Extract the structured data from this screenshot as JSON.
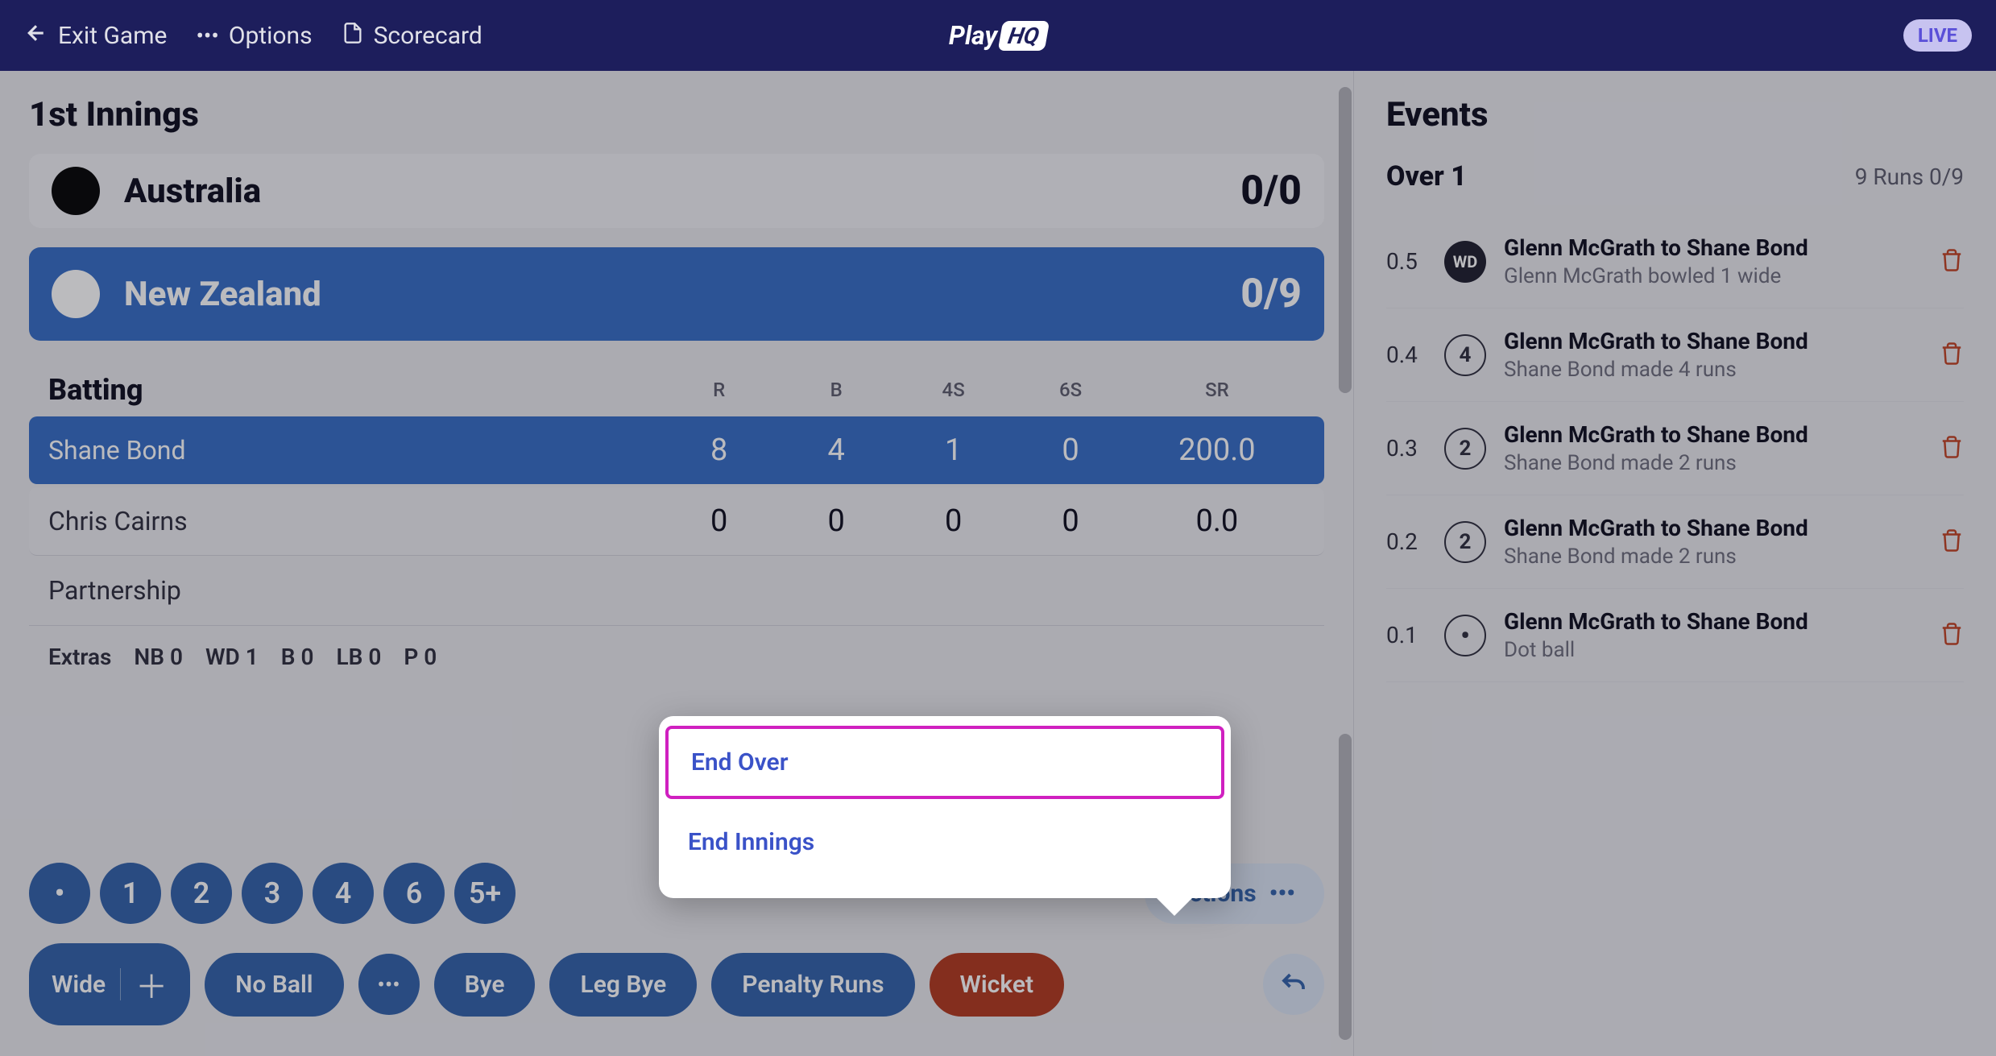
{
  "navbar": {
    "exit_label": "Exit Game",
    "options_label": "Options",
    "scorecard_label": "Scorecard",
    "logo_text": "Play",
    "logo_badge": "HQ",
    "live_label": "LIVE"
  },
  "innings_title": "1st Innings",
  "teams": [
    {
      "name": "Australia",
      "score": "0/0",
      "active": false,
      "dot": "black"
    },
    {
      "name": "New Zealand",
      "score": "0/9",
      "active": true,
      "dot": "white"
    }
  ],
  "batting": {
    "header": "Batting",
    "cols": {
      "r": "R",
      "b": "B",
      "fours": "4S",
      "sixes": "6S",
      "sr": "SR"
    },
    "rows": [
      {
        "name": "Shane Bond",
        "r": "8",
        "b": "4",
        "fours": "1",
        "sixes": "0",
        "sr": "200.0",
        "active": true
      },
      {
        "name": "Chris Cairns",
        "r": "0",
        "b": "0",
        "fours": "0",
        "sixes": "0",
        "sr": "0.0",
        "active": false
      }
    ],
    "partnership_label": "Partnership"
  },
  "extras": {
    "label": "Extras",
    "nb": "NB 0",
    "wd": "WD 1",
    "b": "B 0",
    "lb": "LB 0",
    "p": "P 0"
  },
  "run_buttons": {
    "dot": "•",
    "one": "1",
    "two": "2",
    "three": "3",
    "four": "4",
    "six": "6",
    "fiveplus": "5+"
  },
  "actions": {
    "actions_label": "Actions",
    "wide": "Wide",
    "noball": "No Ball",
    "bye": "Bye",
    "legbye": "Leg Bye",
    "penalty": "Penalty Runs",
    "wicket": "Wicket"
  },
  "popup": {
    "end_over": "End Over",
    "end_innings": "End Innings"
  },
  "events": {
    "title": "Events",
    "over_label": "Over 1",
    "over_summary": "9 Runs  0/9",
    "items": [
      {
        "ball": "0.5",
        "circle": "WD",
        "type": "wd",
        "title": "Glenn McGrath to Shane Bond",
        "desc": "Glenn McGrath bowled 1 wide"
      },
      {
        "ball": "0.4",
        "circle": "4",
        "type": "num",
        "title": "Glenn McGrath to Shane Bond",
        "desc": "Shane Bond made 4 runs"
      },
      {
        "ball": "0.3",
        "circle": "2",
        "type": "num",
        "title": "Glenn McGrath to Shane Bond",
        "desc": "Shane Bond made 2 runs"
      },
      {
        "ball": "0.2",
        "circle": "2",
        "type": "num",
        "title": "Glenn McGrath to Shane Bond",
        "desc": "Shane Bond made 2 runs"
      },
      {
        "ball": "0.1",
        "circle": "",
        "type": "dot",
        "title": "Glenn McGrath to Shane Bond",
        "desc": "Dot ball"
      }
    ]
  }
}
